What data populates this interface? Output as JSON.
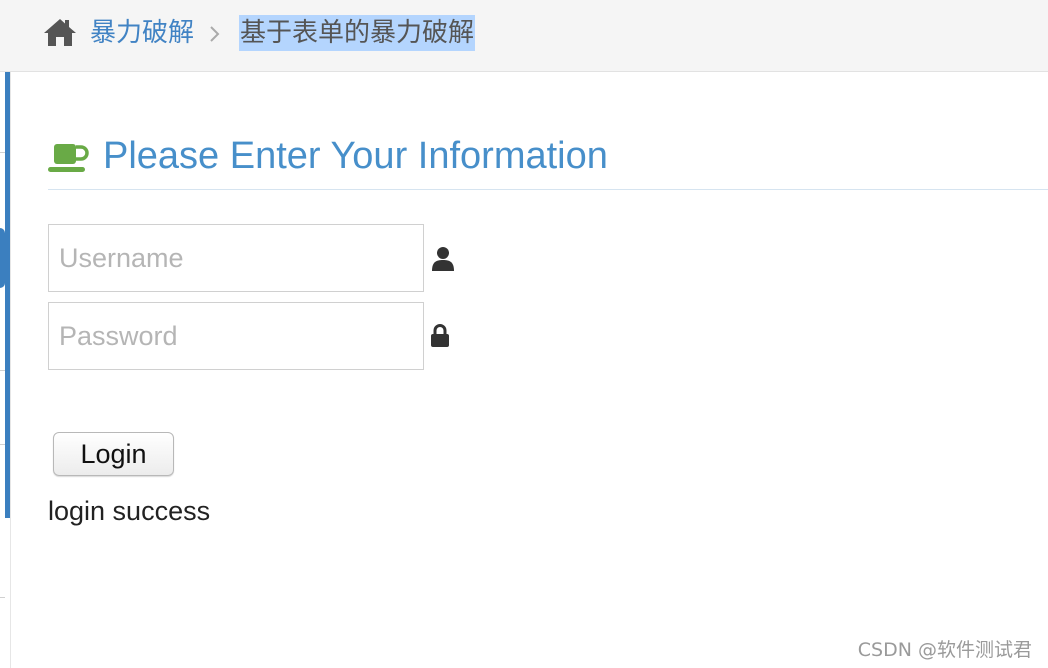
{
  "breadcrumb": {
    "home_icon": "home-icon",
    "parent_label": "暴力破解",
    "separator_icon": "chevron-right-icon",
    "current_label": "基于表单的暴力破解"
  },
  "header": {
    "icon": "coffee-cup-icon",
    "title": "Please Enter Your Information"
  },
  "form": {
    "username_placeholder": "Username",
    "username_value": "",
    "username_icon": "user-icon",
    "password_placeholder": "Password",
    "password_value": "",
    "password_icon": "lock-icon",
    "login_label": "Login"
  },
  "status": {
    "message": "login success"
  },
  "watermark": {
    "text": "CSDN @软件测试君"
  },
  "colors": {
    "accent_blue": "#478fca",
    "link_blue": "#4183c4",
    "cup_green": "#69aa46",
    "selection_highlight": "#b4d5fe"
  }
}
